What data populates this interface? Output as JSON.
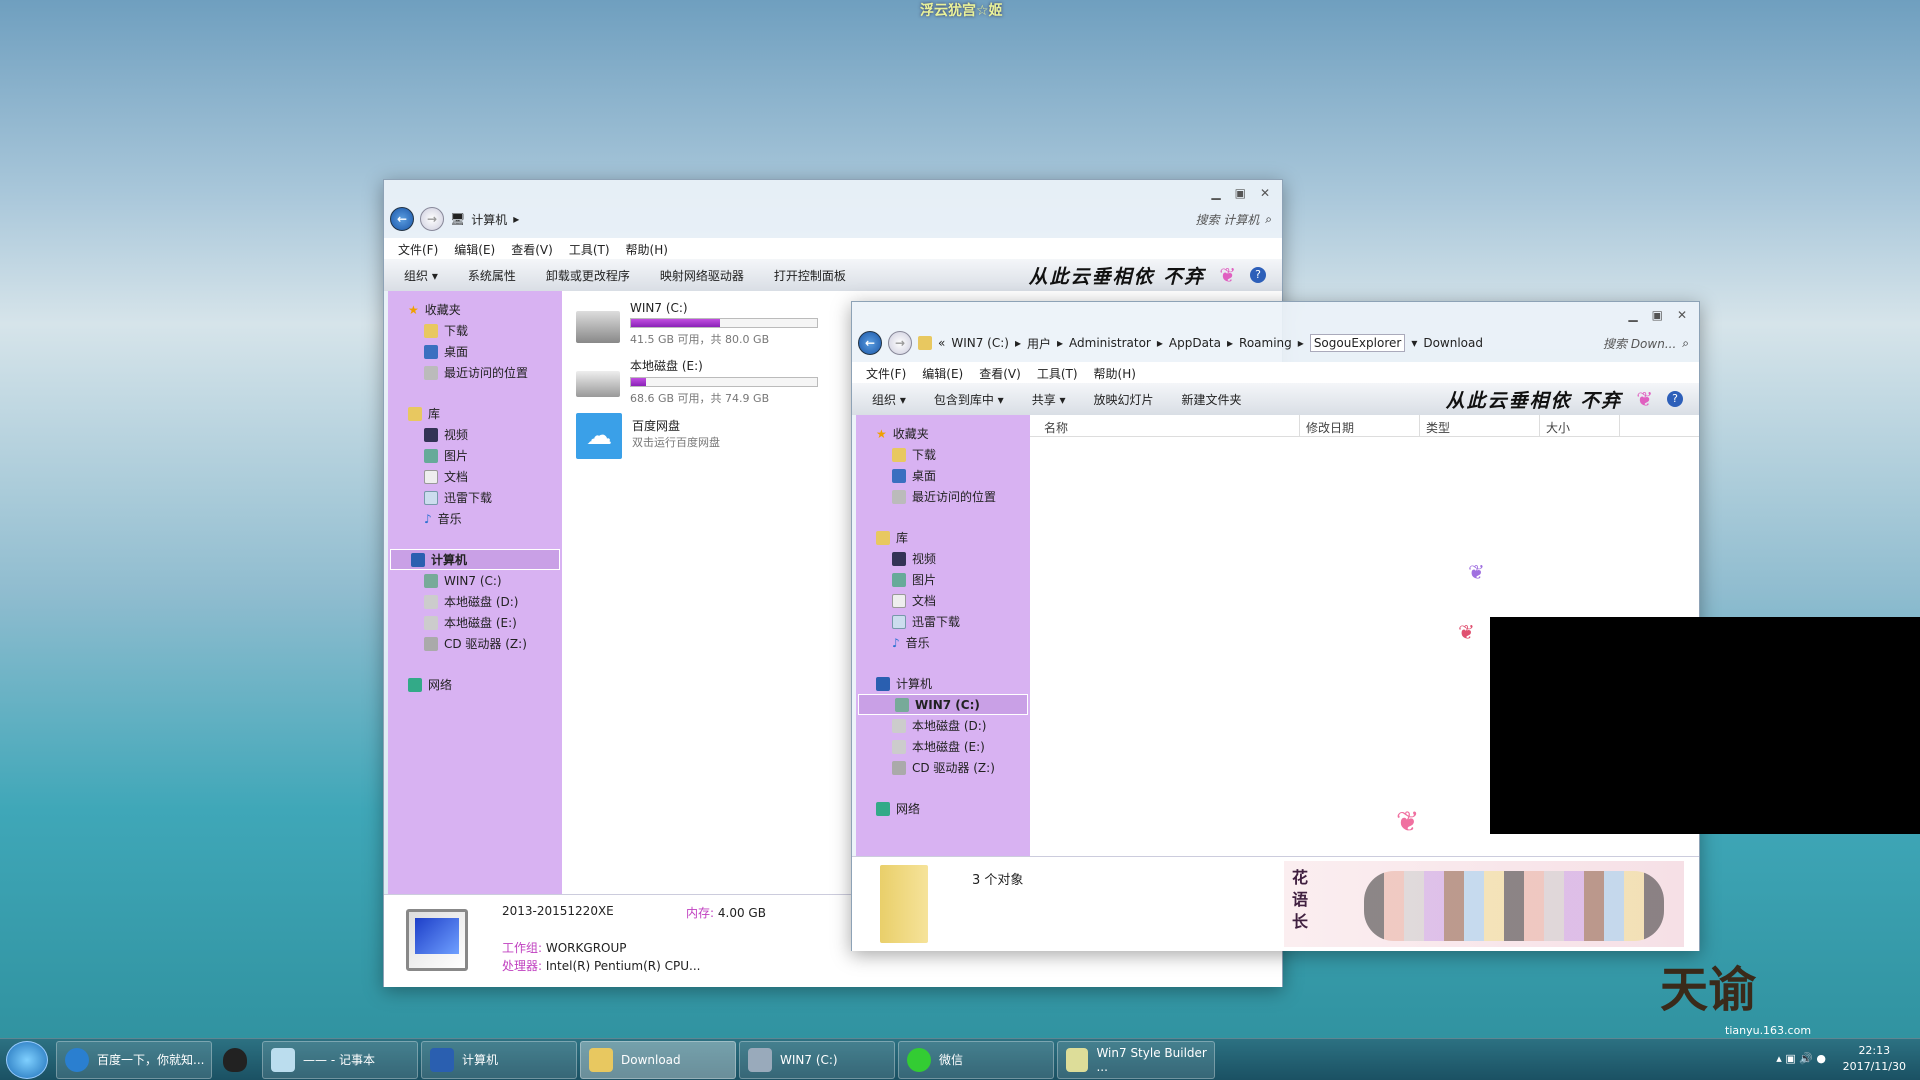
{
  "desktop": {
    "top_caption": "浮云犹宫☆姬",
    "watermark": "tianyu.163.com",
    "logo_text": "天谕"
  },
  "win1": {
    "breadcrumb": [
      "计算机"
    ],
    "search_placeholder": "搜索 计算机",
    "menu": [
      "文件(F)",
      "编辑(E)",
      "查看(V)",
      "工具(T)",
      "帮助(H)"
    ],
    "toolbar": [
      "组织 ▾",
      "系统属性",
      "卸载或更改程序",
      "映射网络驱动器",
      "打开控制面板"
    ],
    "slogan": "从此云垂相依 不弃",
    "nav": {
      "favorites": "收藏夹",
      "fav_items": [
        "下载",
        "桌面",
        "最近访问的位置"
      ],
      "libraries": "库",
      "lib_items": [
        "视频",
        "图片",
        "文档",
        "迅雷下载",
        "音乐"
      ],
      "computer": "计算机",
      "drives": [
        "WIN7 (C:)",
        "本地磁盘 (D:)",
        "本地磁盘 (E:)",
        "CD 驱动器 (Z:)"
      ],
      "network": "网络"
    },
    "drives": [
      {
        "name": "WIN7 (C:)",
        "info": "41.5 GB 可用，共 80.0 GB",
        "used_percent": 48
      },
      {
        "name": "本地磁盘 (E:)",
        "info": "68.6 GB 可用，共 74.9 GB",
        "used_percent": 8
      }
    ],
    "baidu": {
      "name": "百度网盘",
      "desc": "双击运行百度网盘"
    },
    "details": {
      "pc_name": "2013-20151220XE",
      "mem_label": "内存:",
      "mem": "4.00 GB",
      "wg_label": "工作组:",
      "wg": "WORKGROUP",
      "cpu_label": "处理器:",
      "cpu": "Intel(R) Pentium(R) CPU..."
    }
  },
  "win2": {
    "breadcrumb": [
      "«",
      "WIN7 (C:)",
      "用户",
      "Administrator",
      "AppData",
      "Roaming",
      "SogouExplorer",
      "Download"
    ],
    "search_placeholder": "搜索 Down...",
    "menu": [
      "文件(F)",
      "编辑(E)",
      "查看(V)",
      "工具(T)",
      "帮助(H)"
    ],
    "toolbar": [
      "组织 ▾",
      "包含到库中 ▾",
      "共享 ▾",
      "放映幻灯片",
      "新建文件夹"
    ],
    "slogan": "从此云垂相依 不弃",
    "columns": [
      "名称",
      "修改日期",
      "类型",
      "大小"
    ],
    "nav": {
      "favorites": "收藏夹",
      "fav_items": [
        "下载",
        "桌面",
        "最近访问的位置"
      ],
      "libraries": "库",
      "lib_items": [
        "视频",
        "图片",
        "文档",
        "迅雷下载",
        "音乐"
      ],
      "computer": "计算机",
      "drives": [
        "WIN7 (C:)",
        "本地磁盘 (D:)",
        "本地磁盘 (E:)",
        "CD 驱动器 (Z:)"
      ],
      "network": "网络"
    },
    "status": "3 个对象",
    "banner_text": "花语长"
  },
  "taskbar": {
    "items": [
      "百度一下，你就知...",
      "",
      "—— - 记事本",
      "计算机",
      "Download",
      "WIN7 (C:)",
      "微信",
      "Win7 Style Builder ..."
    ],
    "active": "Download",
    "time": "22:13",
    "date": "2017/11/30"
  }
}
